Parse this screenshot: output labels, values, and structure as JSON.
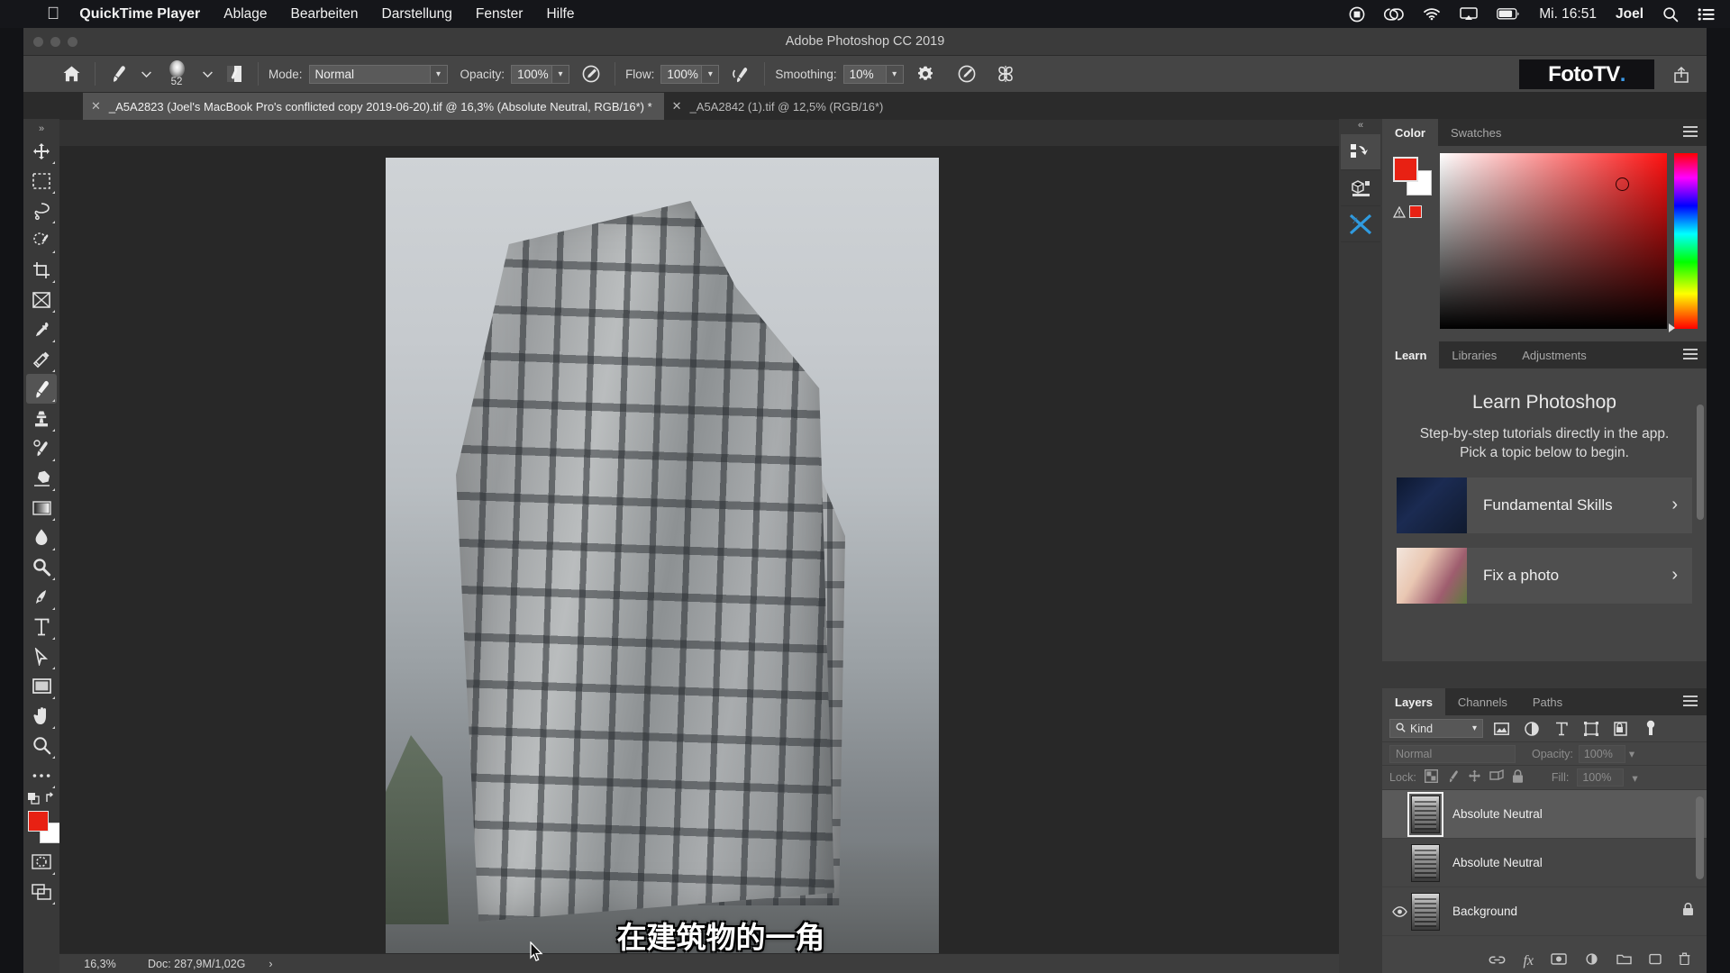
{
  "menubar": {
    "apple_icon": "apple-icon",
    "app_name": "QuickTime Player",
    "items": [
      "Ablage",
      "Bearbeiten",
      "Darstellung",
      "Fenster",
      "Hilfe"
    ],
    "status_icons": [
      "record-stop-icon",
      "creative-cloud-icon",
      "wifi-icon",
      "airplay-icon",
      "battery-icon"
    ],
    "clock": "Mi. 16:51",
    "user": "Joel",
    "search_icon": "search-icon",
    "control-center_icon": "control-center-icon"
  },
  "window": {
    "title": "Adobe Photoshop CC 2019"
  },
  "options_bar": {
    "home_icon": "home-icon",
    "brush_icon": "brush-preset-icon",
    "brush_size": "52",
    "brush_panel_icon": "brush-settings-icon",
    "mode_label": "Mode:",
    "mode_value": "Normal",
    "opacity_label": "Opacity:",
    "opacity_value": "100%",
    "pressure_opacity_icon": "pressure-opacity-icon",
    "flow_label": "Flow:",
    "flow_value": "100%",
    "airbrush_icon": "airbrush-icon",
    "smoothing_label": "Smoothing:",
    "smoothing_value": "10%",
    "smoothing_options_icon": "gear-icon",
    "angle_icon": "brush-angle-icon",
    "symmetry_icon": "symmetry-butterfly-icon",
    "logo_text_a": "FotoTV",
    "logo_dot": ".",
    "share_icon": "share-icon"
  },
  "tabs": [
    {
      "label": "_A5A2823 (Joel's MacBook Pro's conflicted copy 2019-06-20).tif @ 16,3% (Absolute Neutral, RGB/16*) *",
      "active": true,
      "close_icon": "close-icon"
    },
    {
      "label": "_A5A2842 (1).tif @ 12,5% (RGB/16*)",
      "active": false,
      "close_icon": "close-icon"
    }
  ],
  "toolbar": {
    "collapse_icon": "collapse-chevrons-icon",
    "tools": [
      {
        "name": "move-tool",
        "icon": "move-icon",
        "selected": false
      },
      {
        "name": "marquee-tool",
        "icon": "rectangular-marquee-icon",
        "selected": false
      },
      {
        "name": "lasso-tool",
        "icon": "lasso-icon",
        "selected": false
      },
      {
        "name": "quick-selection-tool",
        "icon": "quick-selection-icon",
        "selected": false
      },
      {
        "name": "crop-tool",
        "icon": "crop-icon",
        "selected": false
      },
      {
        "name": "frame-tool",
        "icon": "frame-icon",
        "selected": false
      },
      {
        "name": "eyedropper-tool",
        "icon": "eyedropper-icon",
        "selected": false
      },
      {
        "name": "healing-brush-tool",
        "icon": "spot-healing-icon",
        "selected": false
      },
      {
        "name": "brush-tool",
        "icon": "brush-icon",
        "selected": true
      },
      {
        "name": "clone-stamp-tool",
        "icon": "clone-stamp-icon",
        "selected": false
      },
      {
        "name": "history-brush-tool",
        "icon": "history-brush-icon",
        "selected": false
      },
      {
        "name": "eraser-tool",
        "icon": "eraser-icon",
        "selected": false
      },
      {
        "name": "gradient-tool",
        "icon": "gradient-icon",
        "selected": false
      },
      {
        "name": "blur-tool",
        "icon": "blur-droplet-icon",
        "selected": false
      },
      {
        "name": "dodge-tool",
        "icon": "dodge-icon",
        "selected": false
      },
      {
        "name": "pen-tool",
        "icon": "pen-icon",
        "selected": false
      },
      {
        "name": "type-tool",
        "icon": "type-t-icon",
        "selected": false
      },
      {
        "name": "path-selection-tool",
        "icon": "path-arrow-icon",
        "selected": false
      },
      {
        "name": "shape-tool",
        "icon": "rectangle-shape-icon",
        "selected": false
      },
      {
        "name": "hand-tool",
        "icon": "hand-icon",
        "selected": false
      },
      {
        "name": "zoom-tool",
        "icon": "magnifier-icon",
        "selected": false
      },
      {
        "name": "edit-toolbar",
        "icon": "ellipsis-icon",
        "selected": false
      }
    ],
    "default_colors_icon": "default-colors-icon",
    "swap_colors_icon": "swap-colors-icon",
    "foreground_color": "#e82113",
    "background_color": "#ffffff",
    "quickmask_icon": "quick-mask-icon",
    "screenmode_icon": "screen-mode-icon"
  },
  "canvas": {
    "subtitle_text": "在建筑物的一角",
    "cursor_icon": "arrow-cursor-icon"
  },
  "statusbar": {
    "zoom": "16,3%",
    "doc": "Doc: 287,9M/1,02G",
    "arrow_icon": "chevron-right-icon"
  },
  "rail": {
    "collapse_icon": "collapse-chevrons-icon",
    "buttons": [
      {
        "name": "history-rail-button",
        "icon": "history-icon",
        "selected": true
      },
      {
        "name": "3d-rail-button",
        "icon": "cube-3d-icon",
        "selected": false
      },
      {
        "name": "xbew-rail-button",
        "icon": "blue-x-icon",
        "selected": false
      }
    ]
  },
  "color_panel": {
    "tabs": [
      {
        "label": "Color",
        "active": true
      },
      {
        "label": "Swatches",
        "active": false
      }
    ],
    "menu_icon": "panel-menu-icon",
    "foreground": "#e82113",
    "background": "#ffffff",
    "warning_icon": "gamut-warning-icon",
    "ramp_base": "#ff1111"
  },
  "learn_panel": {
    "tabs": [
      {
        "label": "Learn",
        "active": true
      },
      {
        "label": "Libraries",
        "active": false
      },
      {
        "label": "Adjustments",
        "active": false
      }
    ],
    "menu_icon": "panel-menu-icon",
    "heading": "Learn Photoshop",
    "subheading": "Step-by-step tutorials directly in the app. Pick a topic below to begin.",
    "cards": [
      {
        "label": "Fundamental Skills",
        "chevron": "chevron-right-icon"
      },
      {
        "label": "Fix a photo",
        "chevron": "chevron-right-icon"
      }
    ]
  },
  "layers_panel": {
    "tabs": [
      {
        "label": "Layers",
        "active": true
      },
      {
        "label": "Channels",
        "active": false
      },
      {
        "label": "Paths",
        "active": false
      }
    ],
    "menu_icon": "panel-menu-icon",
    "filter": {
      "search_icon": "search-icon",
      "value": "Kind",
      "caret_icon": "chevron-down-icon"
    },
    "filter_icons": [
      "pixel-layers-icon",
      "adjustment-layers-icon",
      "type-layers-icon",
      "shape-layers-icon",
      "smart-object-icon",
      "filter-toggle-icon"
    ],
    "blend_mode": "Normal",
    "opacity_label": "Opacity:",
    "opacity_value": "100%",
    "lock_label": "Lock:",
    "lock_icons": [
      "lock-transparency-icon",
      "lock-image-icon",
      "lock-position-icon",
      "lock-artboard-icon",
      "lock-all-icon"
    ],
    "fill_label": "Fill:",
    "fill_value": "100%",
    "layers": [
      {
        "name": "Absolute Neutral",
        "selected": true,
        "visible": false,
        "locked": false
      },
      {
        "name": "Absolute Neutral",
        "selected": false,
        "visible": false,
        "locked": false
      },
      {
        "name": "Background",
        "selected": false,
        "visible": true,
        "locked": true
      }
    ],
    "bottom_icons": [
      "link-layers-icon",
      "layer-style-fx-icon",
      "layer-mask-icon",
      "adjustment-layer-icon",
      "new-group-icon",
      "new-layer-icon",
      "delete-layer-icon"
    ]
  }
}
